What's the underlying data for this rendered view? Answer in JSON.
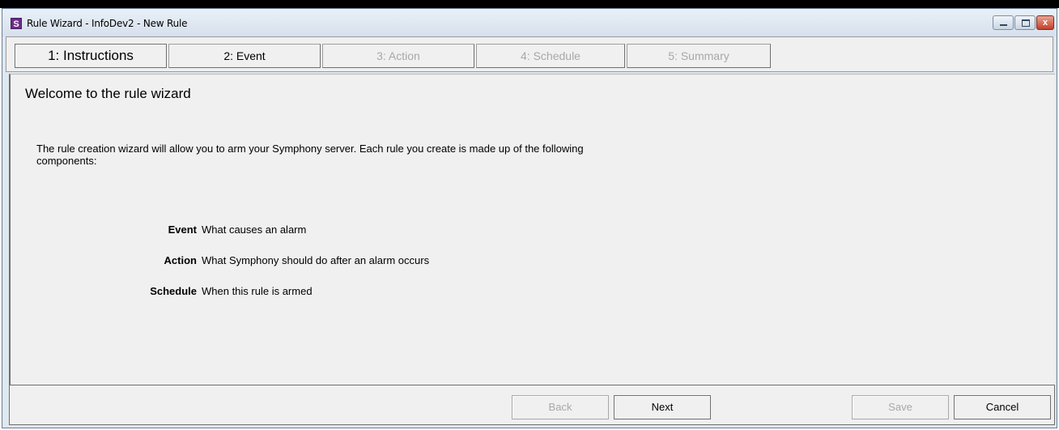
{
  "window": {
    "title": "Rule Wizard - InfoDev2 - New Rule",
    "app_icon_letter": "S",
    "close_glyph": "x"
  },
  "tabs": [
    {
      "label": "1: Instructions",
      "state": "active"
    },
    {
      "label": "2: Event",
      "state": "enabled"
    },
    {
      "label": "3: Action",
      "state": "disabled"
    },
    {
      "label": "4: Schedule",
      "state": "disabled"
    },
    {
      "label": "5: Summary",
      "state": "disabled"
    }
  ],
  "content": {
    "heading": "Welcome to the rule wizard",
    "intro": "The rule creation wizard will allow you to arm your Symphony server.  Each rule you create is made up of the following components:",
    "components": [
      {
        "name": "Event",
        "description": "What causes an alarm"
      },
      {
        "name": "Action",
        "description": "What Symphony should do after an alarm occurs"
      },
      {
        "name": "Schedule",
        "description": "When this rule is armed"
      }
    ]
  },
  "footer": {
    "back_label": "Back",
    "next_label": "Next",
    "save_label": "Save",
    "cancel_label": "Cancel"
  },
  "colors": {
    "app_icon": "#6b2c86",
    "disabled_text": "#a8a8a8",
    "panel_bg": "#f0f0f0"
  }
}
